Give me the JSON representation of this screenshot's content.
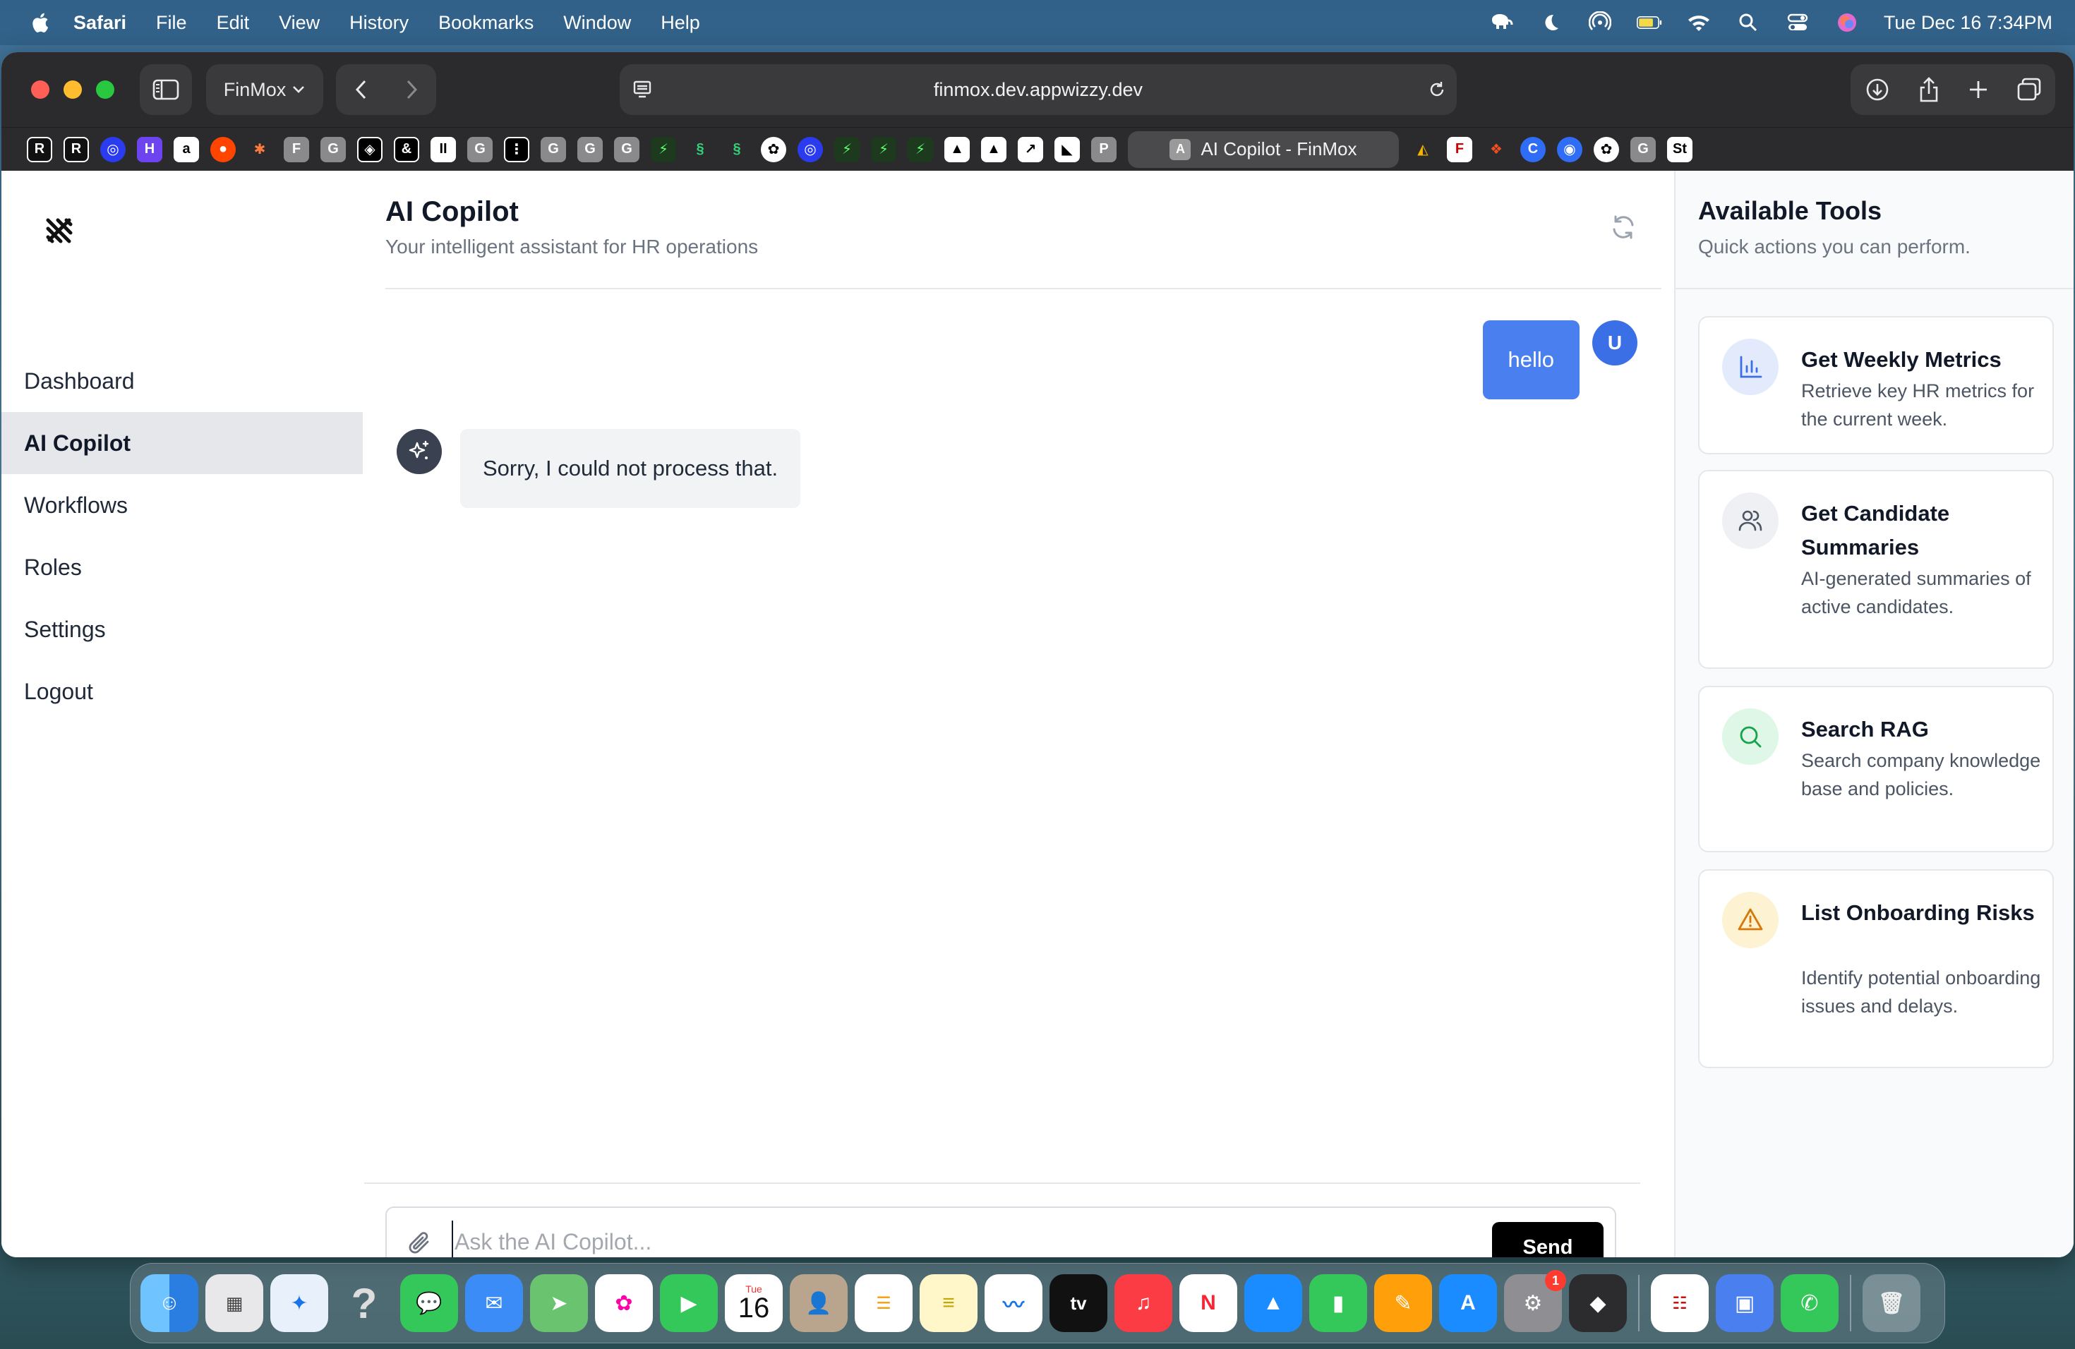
{
  "menubar": {
    "items": [
      "Safari",
      "File",
      "Edit",
      "View",
      "History",
      "Bookmarks",
      "Window",
      "Help"
    ],
    "clock": "Tue Dec 16  7:34PM"
  },
  "browser": {
    "profile_label": "FinMox",
    "url": "finmox.dev.appwizzy.dev",
    "active_tab_title": "AI Copilot - FinMox",
    "active_tab_letter": "A"
  },
  "sidebar": {
    "items": [
      {
        "label": "Dashboard",
        "active": false
      },
      {
        "label": "AI Copilot",
        "active": true
      },
      {
        "label": "Workflows",
        "active": false
      },
      {
        "label": "Roles",
        "active": false
      },
      {
        "label": "Settings",
        "active": false
      },
      {
        "label": "Logout",
        "active": false
      }
    ]
  },
  "main": {
    "title": "AI Copilot",
    "subtitle": "Your intelligent assistant for HR operations",
    "messages": {
      "user": {
        "text": "hello",
        "avatar": "U"
      },
      "bot": {
        "text": "Sorry, I could not process that."
      }
    },
    "composer": {
      "placeholder": "Ask the AI Copilot...",
      "send_label": "Send"
    }
  },
  "tools": {
    "title": "Available Tools",
    "subtitle": "Quick actions you can perform.",
    "items": [
      {
        "title": "Get Weekly Metrics",
        "description": "Retrieve key HR metrics for the current week.",
        "icon": "bar-chart-icon",
        "color": "#3b6fe6"
      },
      {
        "title": "Get Candidate Summaries",
        "description": "AI-generated summaries of active candidates.",
        "icon": "users-icon",
        "color": "#4b5563"
      },
      {
        "title": "Search RAG",
        "description": "Search company knowledge base and policies.",
        "icon": "search-icon",
        "color": "#16a34a"
      },
      {
        "title": "List Onboarding Risks",
        "description": "Identify potential onboarding issues and delays.",
        "icon": "warning-icon",
        "color": "#d97706"
      }
    ]
  },
  "dock": {
    "calendar_month": "Tue",
    "calendar_day": "16",
    "settings_badge": "1"
  },
  "colors": {
    "accent": "#4a7ff0",
    "send_button": "#000000",
    "active_nav": "#e6e7ea"
  }
}
